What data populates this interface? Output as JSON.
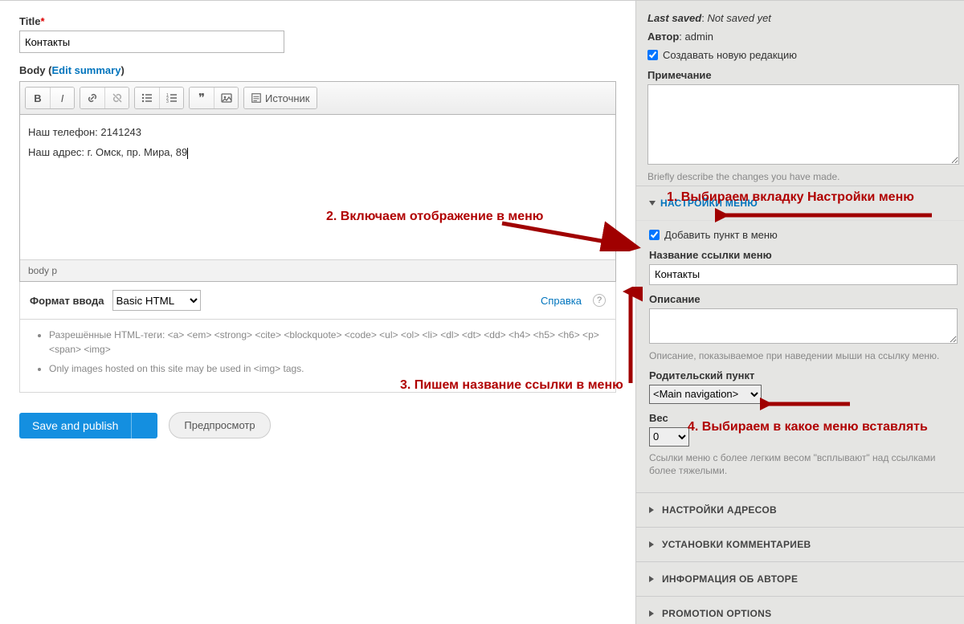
{
  "title": {
    "label": "Title",
    "value": "Контакты"
  },
  "body": {
    "label": "Body",
    "edit_summary": "Edit summary",
    "toolbar": {
      "bold": "B",
      "italic": "I",
      "link": "🔗",
      "unlink": "⛓",
      "ul": "•",
      "ol": "1.",
      "quote": "❝",
      "image": "🖼",
      "source": "Источник"
    },
    "content_line1": "Наш телефон: 2141243",
    "content_line2": "Наш адрес: г. Омск, пр. Мира, 89",
    "statusbar": "body  p"
  },
  "format": {
    "label": "Формат ввода",
    "selected": "Basic HTML",
    "help": "Справка",
    "allowed1": "Разрешённые HTML-теги: <a> <em> <strong> <cite> <blockquote> <code> <ul> <ol> <li> <dl> <dt> <dd> <h4> <h5> <h6> <p> <span> <img>",
    "allowed2": "Only images hosted on this site may be used in <img> tags."
  },
  "actions": {
    "save": "Save and publish",
    "preview": "Предпросмотр"
  },
  "meta": {
    "last_saved_label": "Last saved",
    "last_saved_value": "Not saved yet",
    "author_label": "Автор",
    "author_value": "admin",
    "new_revision": "Создавать новую редакцию",
    "note_label": "Примечание",
    "note_hint": "Briefly describe the changes you have made."
  },
  "menu_settings": {
    "header": "НАСТРОЙКИ МЕНЮ",
    "add_link": "Добавить пункт в меню",
    "link_title_label": "Название ссылки меню",
    "link_title_value": "Контакты",
    "desc_label": "Описание",
    "desc_hint": "Описание, показываемое при наведении мыши на ссылку меню.",
    "parent_label": "Родительский пункт",
    "parent_value": "<Main navigation>",
    "weight_label": "Вес",
    "weight_value": "0",
    "weight_hint": "Ссылки меню с более легким весом \"всплывают\" над ссылками более тяжелыми."
  },
  "accordions": {
    "url": "НАСТРОЙКИ АДРЕСОВ",
    "comments": "УСТАНОВКИ КОММЕНТАРИЕВ",
    "author": "ИНФОРМАЦИЯ ОБ АВТОРЕ",
    "promo": "PROMOTION OPTIONS"
  },
  "annotations": {
    "a1": "1. Выбираем вкладку Настройки меню",
    "a2": "2. Включаем отображение в меню",
    "a3": "3. Пишем название ссылки в меню",
    "a4": "4. Выбираем в какое меню вставлять"
  }
}
